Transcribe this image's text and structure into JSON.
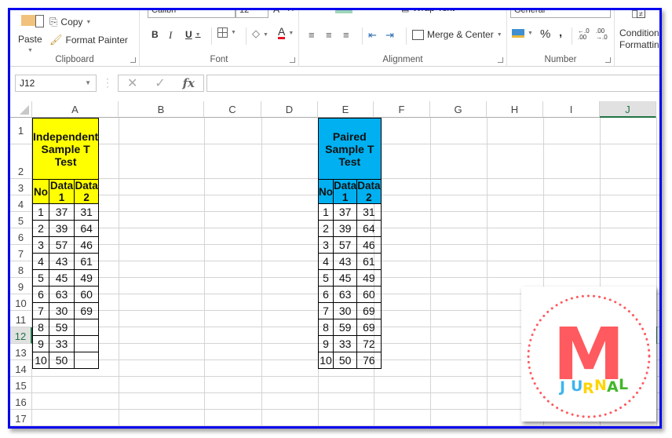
{
  "ribbon": {
    "clipboard": {
      "label": "Clipboard",
      "paste": "Paste",
      "copy": "Copy",
      "format_painter": "Format Painter"
    },
    "font": {
      "label": "Font",
      "font_name": "Calibri",
      "font_size": "12",
      "bold": "B",
      "italic": "I",
      "underline": "U",
      "font_color": "A",
      "font_color_hex": "#e81123"
    },
    "alignment": {
      "label": "Alignment",
      "wrap_text": "Wrap Text",
      "merge_center": "Merge & Center"
    },
    "number": {
      "label": "Number",
      "format": "General",
      "percent": "%",
      "comma": ","
    },
    "styles": {
      "conditional_formatting_line1": "Conditional",
      "conditional_formatting_line2": "Formatting"
    }
  },
  "formula_bar": {
    "name_box": "J12",
    "cancel": "✕",
    "enter": "✓",
    "fx": "fx",
    "value": ""
  },
  "columns": [
    "A",
    "B",
    "C",
    "D",
    "E",
    "F",
    "G",
    "H",
    "I",
    "J"
  ],
  "selected_column": "J",
  "rows": [
    "1",
    "2",
    "3",
    "4",
    "5",
    "6",
    "7",
    "8",
    "9",
    "10",
    "11",
    "12",
    "13",
    "14",
    "15",
    "16",
    "17"
  ],
  "selected_row": "12",
  "independent": {
    "title": "Independent Sample T Test",
    "fill_color": "#ffff00",
    "headers": [
      "No",
      "Data 1",
      "Data 2"
    ],
    "rows": [
      [
        "1",
        "37",
        "31"
      ],
      [
        "2",
        "39",
        "64"
      ],
      [
        "3",
        "57",
        "46"
      ],
      [
        "4",
        "43",
        "61"
      ],
      [
        "5",
        "45",
        "49"
      ],
      [
        "6",
        "63",
        "60"
      ],
      [
        "7",
        "30",
        "69"
      ],
      [
        "8",
        "59",
        ""
      ],
      [
        "9",
        "33",
        ""
      ],
      [
        "10",
        "50",
        ""
      ]
    ]
  },
  "paired": {
    "title": "Paired Sample T Test",
    "fill_color": "#00b0f0",
    "headers": [
      "No",
      "Data 1",
      "Data 2"
    ],
    "rows": [
      [
        "1",
        "37",
        "31"
      ],
      [
        "2",
        "39",
        "64"
      ],
      [
        "3",
        "57",
        "46"
      ],
      [
        "4",
        "43",
        "61"
      ],
      [
        "5",
        "45",
        "49"
      ],
      [
        "6",
        "63",
        "60"
      ],
      [
        "7",
        "30",
        "69"
      ],
      [
        "8",
        "59",
        "69"
      ],
      [
        "9",
        "33",
        "72"
      ],
      [
        "10",
        "50",
        "76"
      ]
    ]
  },
  "logo": {
    "letter": "M",
    "word": [
      "J",
      "U",
      "R",
      "N",
      "A",
      "L"
    ],
    "letter_color": "#ff5a5f",
    "word_colors": [
      "#3fb4f0",
      "#3fb4f0",
      "#ffd400",
      "#ffd400",
      "#42b72a",
      "#42b72a"
    ]
  }
}
